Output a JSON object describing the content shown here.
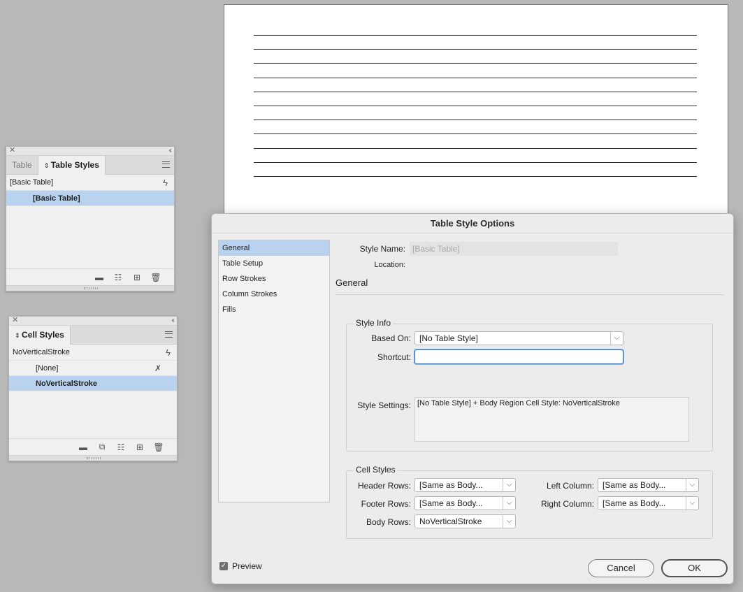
{
  "document": {
    "rule_count": 11
  },
  "table_styles_panel": {
    "tabs": [
      "Table",
      "Table Styles"
    ],
    "current_style": "[Basic Table]",
    "items": [
      "[Basic Table]"
    ],
    "footer_icons": [
      "folder-icon",
      "load-styles-icon",
      "new-style-icon",
      "trash-icon"
    ]
  },
  "cell_styles_panel": {
    "tab": "Cell Styles",
    "current_style": "NoVerticalStroke",
    "items": [
      "[None]",
      "NoVerticalStroke"
    ],
    "footer_icons": [
      "folder-icon",
      "convert-icon",
      "load-styles-icon",
      "new-style-icon",
      "trash-icon"
    ]
  },
  "dialog": {
    "title": "Table Style Options",
    "nav": [
      "General",
      "Table Setup",
      "Row Strokes",
      "Column Strokes",
      "Fills"
    ],
    "style_name_label": "Style Name:",
    "style_name_value": "[Basic Table]",
    "location_label": "Location:",
    "section_title": "General",
    "style_info": {
      "legend": "Style Info",
      "based_on_label": "Based On:",
      "based_on_value": "[No Table Style]",
      "shortcut_label": "Shortcut:",
      "shortcut_value": "",
      "style_settings_label": "Style Settings:",
      "style_settings_value": "[No Table Style] + Body Region Cell Style: NoVerticalStroke"
    },
    "cell_styles": {
      "legend": "Cell Styles",
      "header_rows_label": "Header Rows:",
      "header_rows_value": "[Same as Body...",
      "footer_rows_label": "Footer Rows:",
      "footer_rows_value": "[Same as Body...",
      "body_rows_label": "Body Rows:",
      "body_rows_value": "NoVerticalStroke",
      "left_column_label": "Left Column:",
      "left_column_value": "[Same as Body...",
      "right_column_label": "Right Column:",
      "right_column_value": "[Same as Body..."
    },
    "preview_label": "Preview",
    "preview_checked": true,
    "cancel_label": "Cancel",
    "ok_label": "OK"
  },
  "colors": {
    "selection": "#b8d2f0",
    "focus": "#2f75c6",
    "canvas": "#b9b9b9"
  }
}
